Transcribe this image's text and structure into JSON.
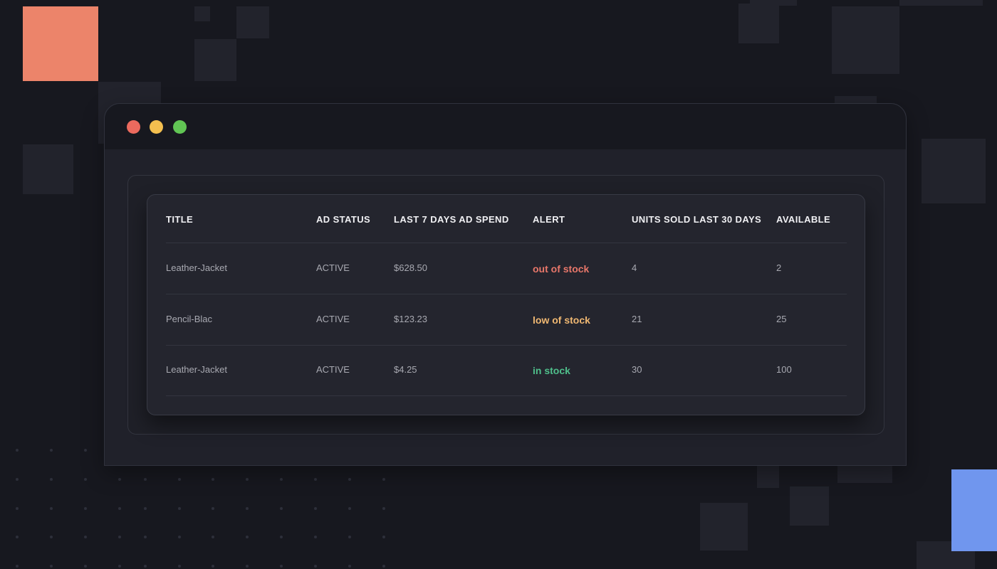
{
  "window": {
    "controls": [
      "close",
      "minimize",
      "maximize"
    ],
    "control_colors": {
      "close": "#ec6a5e",
      "minimize": "#f4bf4f",
      "maximize": "#61c554"
    }
  },
  "colors": {
    "background": "#17181f",
    "accent_orange": "#ec846a",
    "accent_blue": "#7096ee"
  },
  "table": {
    "columns": [
      "TITLE",
      "AD STATUS",
      "LAST 7 DAYS AD SPEND",
      "ALERT",
      "UNITS SOLD LAST 30 DAYS",
      "AVAILABLE"
    ],
    "rows": [
      {
        "title": "Leather-Jacket",
        "ad_status": "ACTIVE",
        "spend": "$628.50",
        "alert": "out of stock",
        "alert_color": "#e8776a",
        "units_sold": "4",
        "available": "2"
      },
      {
        "title": "Pencil-Blac",
        "ad_status": "ACTIVE",
        "spend": "$123.23",
        "alert": "low of stock",
        "alert_color": "#f0b872",
        "units_sold": "21",
        "available": "25"
      },
      {
        "title": "Leather-Jacket",
        "ad_status": "ACTIVE",
        "spend": "$4.25",
        "alert": "in stock",
        "alert_color": "#4fbf8b",
        "units_sold": "30",
        "available": "100"
      }
    ]
  }
}
